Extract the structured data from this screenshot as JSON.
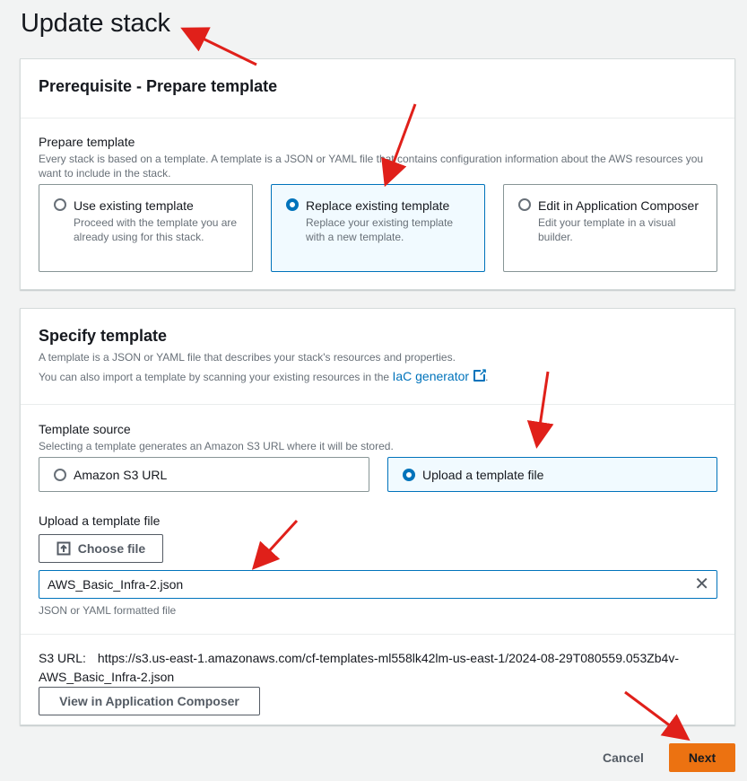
{
  "page_title": "Update stack",
  "prereq": {
    "heading": "Prerequisite - Prepare template",
    "label": "Prepare template",
    "description": "Every stack is based on a template. A template is a JSON or YAML file that contains configuration information about the AWS resources you want to include in the stack.",
    "options": [
      {
        "title": "Use existing template",
        "desc": "Proceed with the template you are already using for this stack.",
        "selected": false
      },
      {
        "title": "Replace existing template",
        "desc": "Replace your existing template with a new template.",
        "selected": true
      },
      {
        "title": "Edit in Application Composer",
        "desc": "Edit your template in a visual builder.",
        "selected": false
      }
    ]
  },
  "specify": {
    "heading": "Specify template",
    "desc1": "A template is a JSON or YAML file that describes your stack's resources and properties.",
    "desc2_prefix": "You can also import a template by scanning your existing resources in the",
    "desc2_link": "IaC generator",
    "desc2_suffix": ".",
    "source_label": "Template source",
    "source_desc": "Selecting a template generates an Amazon S3 URL where it will be stored.",
    "sources": [
      {
        "title": "Amazon S3 URL",
        "selected": false
      },
      {
        "title": "Upload a template file",
        "selected": true
      }
    ],
    "upload_label": "Upload a template file",
    "choose_file": "Choose file",
    "file_value": "AWS_Basic_Infra-2.json",
    "file_hint": "JSON or YAML formatted file",
    "s3_label": "S3 URL:",
    "s3_value_line1": "https://s3.us-east-1.amazonaws.com/cf-templates-ml558lk42lm-us-east-1/2024-08-29T080559.053Zb4v-",
    "s3_value_line2": "AWS_Basic_Infra-2.json",
    "view_composer": "View in Application Composer"
  },
  "footer": {
    "cancel": "Cancel",
    "next": "Next"
  },
  "colors": {
    "accent": "#0073bb",
    "primary_button": "#ec7211",
    "annotation_arrow": "#e0201a"
  }
}
